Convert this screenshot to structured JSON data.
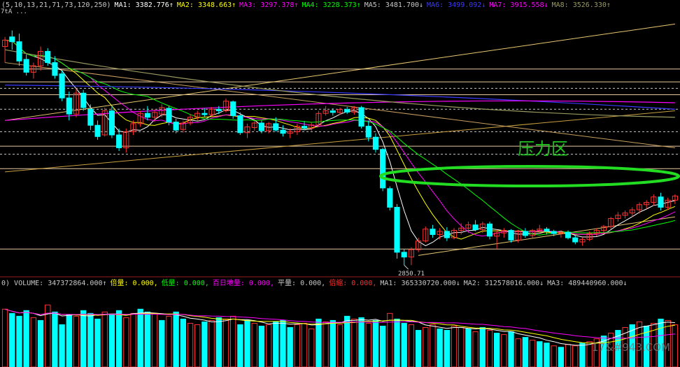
{
  "main_header": [
    {
      "text": "(5,10,13,21,71,73,120,250)",
      "color": "#c8c8c8"
    },
    {
      "text": "MA1: 3382.776↑",
      "color": "#ffffff"
    },
    {
      "text": "MA2: 3348.663↑",
      "color": "#ffff00"
    },
    {
      "text": "MA3: 3297.378↑",
      "color": "#ff00ff"
    },
    {
      "text": "MA4: 3228.373↑",
      "color": "#00ff00"
    },
    {
      "text": "MA5: 3481.700↓",
      "color": "#c8c8c8"
    },
    {
      "text": "MA6: 3499.092↓",
      "color": "#3a3aff"
    },
    {
      "text": "MA7: 3915.558↓",
      "color": "#ff00ff"
    },
    {
      "text": "MA8: 3526.330↑",
      "color": "#9a9a60"
    }
  ],
  "volume_header": [
    {
      "text": "0) VOLUME: 347372864.000↑",
      "color": "#c8c8c8"
    },
    {
      "text": "倍量: 0.000,",
      "color": "#ffff00"
    },
    {
      "text": "低量: 0.000,",
      "color": "#00ff00"
    },
    {
      "text": "百日地量: 0.000,",
      "color": "#ff00ff"
    },
    {
      "text": "平量: 0.000,",
      "color": "#c8c8c8"
    },
    {
      "text": "倍缩: 0.000,",
      "color": "#ff3030"
    },
    {
      "text": "MA1: 365330720.000↓",
      "color": "#c8c8c8"
    },
    {
      "text": "MA2: 312578016.000↓",
      "color": "#c8c8c8"
    },
    {
      "text": "MA3: 489440960.000↓",
      "color": "#c8c8c8"
    }
  ],
  "annotations": {
    "pressure_zone": "压力区",
    "low_price": "2850.71",
    "corner_tag": "7tA ...",
    "watermark": "17&#943.COM"
  },
  "colors": {
    "background": "#000000",
    "up": "#ff3232",
    "down": "#00ffff",
    "ellipse": "#22dd22",
    "grid_red": "#9a2020",
    "dashed": "#c8c8c8",
    "ma1": "#ffffff",
    "ma2": "#ffff00",
    "ma3": "#ff00ff",
    "ma4": "#00ff00",
    "ma6": "#3a3aff",
    "ma7": "#ff00ff",
    "ma8": "#9a9a60"
  },
  "chart_data": [
    {
      "type": "candlestick",
      "panel": "price",
      "ylim": [
        2820,
        3640
      ],
      "horizontal_lines": [
        3460,
        3420,
        3380,
        3220,
        3150,
        2900
      ],
      "dashed_lines": [
        3400,
        3335,
        3265,
        3195
      ],
      "candles": [
        {
          "o": 3530,
          "h": 3560,
          "l": 3480,
          "c": 3550
        },
        {
          "o": 3560,
          "h": 3580,
          "l": 3520,
          "c": 3545
        },
        {
          "o": 3545,
          "h": 3570,
          "l": 3470,
          "c": 3485
        },
        {
          "o": 3490,
          "h": 3505,
          "l": 3440,
          "c": 3450
        },
        {
          "o": 3450,
          "h": 3480,
          "l": 3430,
          "c": 3470
        },
        {
          "o": 3470,
          "h": 3530,
          "l": 3455,
          "c": 3515
        },
        {
          "o": 3515,
          "h": 3525,
          "l": 3470,
          "c": 3480
        },
        {
          "o": 3480,
          "h": 3500,
          "l": 3430,
          "c": 3440
        },
        {
          "o": 3445,
          "h": 3455,
          "l": 3360,
          "c": 3370
        },
        {
          "o": 3370,
          "h": 3390,
          "l": 3300,
          "c": 3320
        },
        {
          "o": 3320,
          "h": 3400,
          "l": 3310,
          "c": 3385
        },
        {
          "o": 3385,
          "h": 3395,
          "l": 3330,
          "c": 3340
        },
        {
          "o": 3335,
          "h": 3350,
          "l": 3270,
          "c": 3285
        },
        {
          "o": 3285,
          "h": 3300,
          "l": 3240,
          "c": 3250
        },
        {
          "o": 3255,
          "h": 3340,
          "l": 3250,
          "c": 3330
        },
        {
          "o": 3330,
          "h": 3345,
          "l": 3245,
          "c": 3255
        },
        {
          "o": 3255,
          "h": 3275,
          "l": 3205,
          "c": 3215
        },
        {
          "o": 3215,
          "h": 3275,
          "l": 3200,
          "c": 3265
        },
        {
          "o": 3265,
          "h": 3300,
          "l": 3255,
          "c": 3290
        },
        {
          "o": 3290,
          "h": 3330,
          "l": 3280,
          "c": 3322
        },
        {
          "o": 3322,
          "h": 3345,
          "l": 3300,
          "c": 3310
        },
        {
          "o": 3310,
          "h": 3335,
          "l": 3295,
          "c": 3325
        },
        {
          "o": 3320,
          "h": 3350,
          "l": 3310,
          "c": 3340
        },
        {
          "o": 3338,
          "h": 3345,
          "l": 3285,
          "c": 3295
        },
        {
          "o": 3295,
          "h": 3305,
          "l": 3260,
          "c": 3270
        },
        {
          "o": 3272,
          "h": 3300,
          "l": 3262,
          "c": 3292
        },
        {
          "o": 3292,
          "h": 3320,
          "l": 3285,
          "c": 3310
        },
        {
          "o": 3310,
          "h": 3330,
          "l": 3300,
          "c": 3322
        },
        {
          "o": 3322,
          "h": 3338,
          "l": 3312,
          "c": 3318
        },
        {
          "o": 3318,
          "h": 3342,
          "l": 3312,
          "c": 3335
        },
        {
          "o": 3335,
          "h": 3345,
          "l": 3320,
          "c": 3330
        },
        {
          "o": 3330,
          "h": 3368,
          "l": 3325,
          "c": 3360
        },
        {
          "o": 3358,
          "h": 3362,
          "l": 3305,
          "c": 3315
        },
        {
          "o": 3315,
          "h": 3325,
          "l": 3255,
          "c": 3262
        },
        {
          "o": 3262,
          "h": 3290,
          "l": 3245,
          "c": 3280
        },
        {
          "o": 3278,
          "h": 3300,
          "l": 3268,
          "c": 3292
        },
        {
          "o": 3292,
          "h": 3300,
          "l": 3260,
          "c": 3268
        },
        {
          "o": 3268,
          "h": 3295,
          "l": 3260,
          "c": 3290
        },
        {
          "o": 3290,
          "h": 3310,
          "l": 3265,
          "c": 3270
        },
        {
          "o": 3270,
          "h": 3285,
          "l": 3250,
          "c": 3260
        },
        {
          "o": 3260,
          "h": 3275,
          "l": 3245,
          "c": 3265
        },
        {
          "o": 3265,
          "h": 3290,
          "l": 3255,
          "c": 3282
        },
        {
          "o": 3282,
          "h": 3298,
          "l": 3270,
          "c": 3276
        },
        {
          "o": 3276,
          "h": 3295,
          "l": 3268,
          "c": 3286
        },
        {
          "o": 3286,
          "h": 3330,
          "l": 3280,
          "c": 3322
        },
        {
          "o": 3322,
          "h": 3345,
          "l": 3315,
          "c": 3330
        },
        {
          "o": 3330,
          "h": 3338,
          "l": 3315,
          "c": 3325
        },
        {
          "o": 3325,
          "h": 3340,
          "l": 3318,
          "c": 3334
        },
        {
          "o": 3334,
          "h": 3342,
          "l": 3320,
          "c": 3326
        },
        {
          "o": 3326,
          "h": 3345,
          "l": 3318,
          "c": 3340
        },
        {
          "o": 3340,
          "h": 3345,
          "l": 3275,
          "c": 3282
        },
        {
          "o": 3282,
          "h": 3300,
          "l": 3235,
          "c": 3248
        },
        {
          "o": 3248,
          "h": 3260,
          "l": 3200,
          "c": 3210
        },
        {
          "o": 3210,
          "h": 3215,
          "l": 3080,
          "c": 3090
        },
        {
          "o": 3088,
          "h": 3095,
          "l": 3020,
          "c": 3030
        },
        {
          "o": 3030,
          "h": 3040,
          "l": 2870,
          "c": 2890
        },
        {
          "o": 2890,
          "h": 2900,
          "l": 2850,
          "c": 2875
        },
        {
          "o": 2875,
          "h": 2905,
          "l": 2850,
          "c": 2898
        },
        {
          "o": 2898,
          "h": 2935,
          "l": 2890,
          "c": 2925
        },
        {
          "o": 2925,
          "h": 2970,
          "l": 2920,
          "c": 2962
        },
        {
          "o": 2962,
          "h": 2975,
          "l": 2935,
          "c": 2945
        },
        {
          "o": 2945,
          "h": 2965,
          "l": 2930,
          "c": 2955
        },
        {
          "o": 2955,
          "h": 2968,
          "l": 2925,
          "c": 2935
        },
        {
          "o": 2935,
          "h": 2965,
          "l": 2930,
          "c": 2958
        },
        {
          "o": 2958,
          "h": 2980,
          "l": 2945,
          "c": 2965
        },
        {
          "o": 2965,
          "h": 2985,
          "l": 2950,
          "c": 2975
        },
        {
          "o": 2975,
          "h": 2990,
          "l": 2955,
          "c": 2960
        },
        {
          "o": 2960,
          "h": 2985,
          "l": 2950,
          "c": 2978
        },
        {
          "o": 2978,
          "h": 2985,
          "l": 2930,
          "c": 2940
        },
        {
          "o": 2940,
          "h": 2960,
          "l": 2900,
          "c": 2950
        },
        {
          "o": 2950,
          "h": 2965,
          "l": 2935,
          "c": 2958
        },
        {
          "o": 2958,
          "h": 2962,
          "l": 2920,
          "c": 2928
        },
        {
          "o": 2928,
          "h": 2960,
          "l": 2920,
          "c": 2955
        },
        {
          "o": 2955,
          "h": 2965,
          "l": 2935,
          "c": 2942
        },
        {
          "o": 2942,
          "h": 2962,
          "l": 2935,
          "c": 2958
        },
        {
          "o": 2958,
          "h": 2975,
          "l": 2950,
          "c": 2962
        },
        {
          "o": 2962,
          "h": 2968,
          "l": 2945,
          "c": 2955
        },
        {
          "o": 2955,
          "h": 2960,
          "l": 2940,
          "c": 2948
        },
        {
          "o": 2948,
          "h": 2958,
          "l": 2935,
          "c": 2952
        },
        {
          "o": 2952,
          "h": 2958,
          "l": 2930,
          "c": 2935
        },
        {
          "o": 2935,
          "h": 2942,
          "l": 2915,
          "c": 2922
        },
        {
          "o": 2922,
          "h": 2935,
          "l": 2910,
          "c": 2930
        },
        {
          "o": 2930,
          "h": 2955,
          "l": 2925,
          "c": 2948
        },
        {
          "o": 2948,
          "h": 2965,
          "l": 2940,
          "c": 2958
        },
        {
          "o": 2958,
          "h": 2975,
          "l": 2950,
          "c": 2970
        },
        {
          "o": 2970,
          "h": 3000,
          "l": 2962,
          "c": 2995
        },
        {
          "o": 2995,
          "h": 3015,
          "l": 2985,
          "c": 3005
        },
        {
          "o": 3005,
          "h": 3020,
          "l": 2995,
          "c": 3012
        },
        {
          "o": 3012,
          "h": 3030,
          "l": 3000,
          "c": 3022
        },
        {
          "o": 3022,
          "h": 3045,
          "l": 3010,
          "c": 3038
        },
        {
          "o": 3038,
          "h": 3052,
          "l": 3025,
          "c": 3045
        },
        {
          "o": 3045,
          "h": 3070,
          "l": 3035,
          "c": 3062
        },
        {
          "o": 3062,
          "h": 3075,
          "l": 3020,
          "c": 3030
        },
        {
          "o": 3030,
          "h": 3060,
          "l": 3022,
          "c": 3052
        },
        {
          "o": 3052,
          "h": 3070,
          "l": 3040,
          "c": 3065
        }
      ]
    },
    {
      "type": "bar",
      "panel": "volume",
      "ylim": [
        0,
        560000000
      ],
      "values": [
        410,
        380,
        360,
        400,
        350,
        330,
        440,
        390,
        300,
        370,
        360,
        400,
        380,
        340,
        390,
        370,
        400,
        350,
        380,
        410,
        390,
        380,
        330,
        360,
        390,
        340,
        310,
        300,
        320,
        330,
        350,
        340,
        360,
        300,
        330,
        310,
        290,
        300,
        320,
        330,
        280,
        300,
        310,
        270,
        340,
        320,
        330,
        300,
        360,
        340,
        350,
        310,
        330,
        290,
        380,
        340,
        310,
        300,
        260,
        280,
        300,
        270,
        260,
        290,
        280,
        270,
        250,
        280,
        260,
        240,
        230,
        250,
        200,
        210,
        190,
        180,
        170,
        150,
        140,
        160,
        150,
        170,
        180,
        200,
        220,
        240,
        260,
        280,
        300,
        320,
        290,
        310,
        340,
        330,
        300
      ],
      "colors": [
        "up",
        "down",
        "down",
        "down",
        "up",
        "down",
        "up",
        "down",
        "down",
        "down",
        "up",
        "down",
        "down",
        "down",
        "up",
        "down",
        "down",
        "up",
        "up",
        "down",
        "down",
        "up",
        "down",
        "up",
        "down",
        "down",
        "up",
        "up",
        "down",
        "up",
        "down",
        "up",
        "up",
        "down",
        "down",
        "up",
        "down",
        "up",
        "down",
        "down",
        "down",
        "up",
        "up",
        "up",
        "down",
        "up",
        "down",
        "up",
        "down",
        "up",
        "down",
        "up",
        "down",
        "down",
        "up",
        "down",
        "down",
        "up",
        "down",
        "up",
        "up",
        "down",
        "down",
        "up",
        "up",
        "down",
        "up",
        "down",
        "up",
        "down",
        "up",
        "down",
        "up",
        "down",
        "up",
        "down",
        "down",
        "up",
        "down",
        "up",
        "up",
        "down",
        "up",
        "up",
        "down",
        "up",
        "down",
        "up",
        "down",
        "up",
        "down",
        "up",
        "down",
        "up",
        "up"
      ]
    }
  ]
}
